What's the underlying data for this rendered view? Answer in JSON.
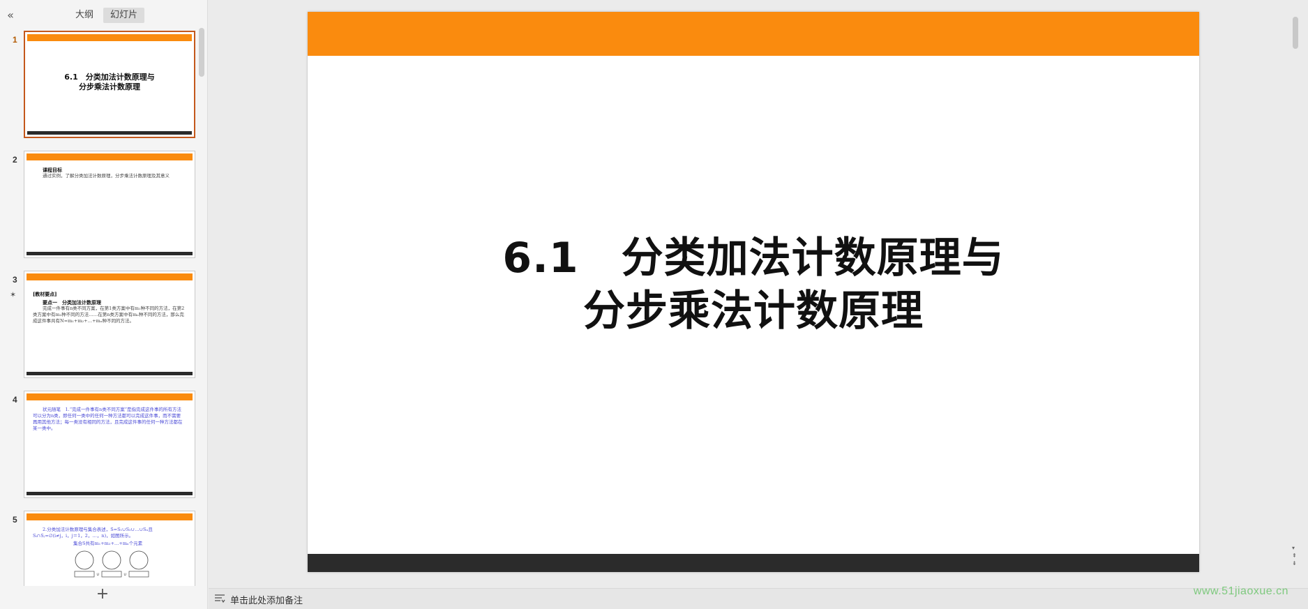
{
  "left_panel": {
    "collapse_icon": "double-chevron-left-icon",
    "tabs": [
      {
        "label": "大纲"
      },
      {
        "label": "幻灯片"
      }
    ],
    "add_icon": "plus-icon",
    "thumbnails": [
      {
        "number": "1",
        "title_line1": "6.1　分类加法计数原理与",
        "title_line2": "分步乘法计数原理"
      },
      {
        "number": "2",
        "head": "课程目标",
        "text": "通过实例，了解分类加法计数原理，分步乘法计数原理及其意义"
      },
      {
        "number": "3",
        "head": "[教材要点]",
        "sub": "要点一　分类加法计数原理",
        "text": "完成一件事有n类不同方案，在第1类方案中有m₁种不同的方法，在第2类方案中有m₂种不同的方法……在第n类方案中有mₙ种不同的方法，那么完成这件事共有N=m₁+m₂+…+mₙ种不同的方法。"
      },
      {
        "number": "4",
        "text": "状元随笔　1.“完成一件事有n类不同方案”是指完成这件事的所有方法可以分为n类，即任何一类中的任何一种方法都可以完成这件事，而不需要再用其他方法；每一类没有相同的方法，且完成这件事的任何一种方法都在某一类中。"
      },
      {
        "number": "5",
        "text": "2.分类加法计数原理与集合表述，S=S₁∪S₂∪…∪Sₙ且Sᵢ∩Sⱼ=∅(i≠j，i，j＝1，2，…，n)，如图所示。",
        "text2": "集合S共有m₁+m₂+…+mₙ个元素"
      }
    ]
  },
  "slide": {
    "title_line1": "6.1　分类加法计数原理与",
    "title_line2": "分步乘法计数原理",
    "accent_color": "#fa8b0e",
    "footer_color": "#2b2b2b"
  },
  "notes": {
    "icon": "notes-list-icon",
    "placeholder": "单击此处添加备注"
  },
  "watermark": "www.51jiaoxue.cn"
}
